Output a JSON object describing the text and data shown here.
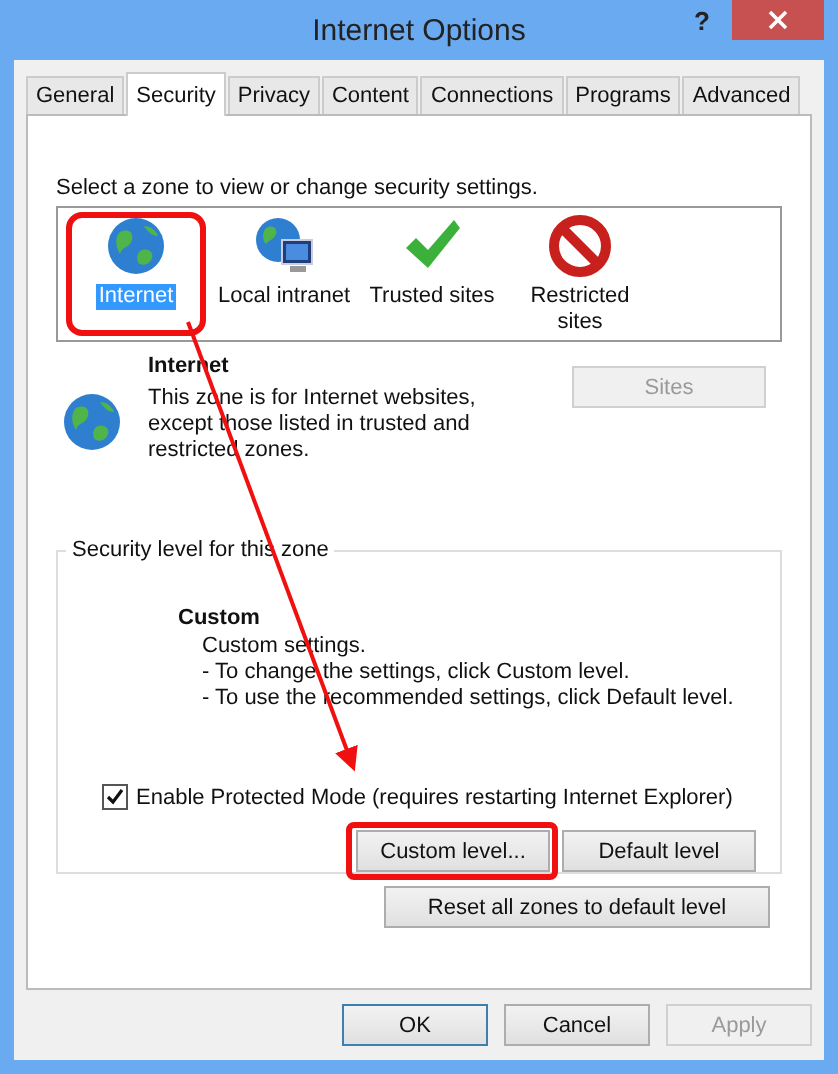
{
  "window": {
    "title": "Internet Options",
    "help": "?"
  },
  "tabs": [
    {
      "label": "General",
      "selected": false
    },
    {
      "label": "Security",
      "selected": true
    },
    {
      "label": "Privacy",
      "selected": false
    },
    {
      "label": "Content",
      "selected": false
    },
    {
      "label": "Connections",
      "selected": false
    },
    {
      "label": "Programs",
      "selected": false
    },
    {
      "label": "Advanced",
      "selected": false
    }
  ],
  "zone_prompt": "Select a zone to view or change security settings.",
  "zones": [
    {
      "kind": "globe",
      "label": "Internet",
      "selected": true
    },
    {
      "kind": "intranet",
      "label": "Local intranet",
      "selected": false
    },
    {
      "kind": "trusted",
      "label": "Trusted sites",
      "selected": false
    },
    {
      "kind": "restricted",
      "label": "Restricted sites",
      "selected": false
    }
  ],
  "zone_info": {
    "title": "Internet",
    "description": "This zone is for Internet websites, except those listed in trusted and restricted zones."
  },
  "sites_button": {
    "label": "Sites",
    "disabled": true
  },
  "security_level": {
    "legend": "Security level for this zone",
    "level_name": "Custom",
    "lines": [
      "Custom settings.",
      "- To change the settings, click Custom level.",
      "- To use the recommended settings, click Default level."
    ],
    "protected_mode": {
      "label": "Enable Protected Mode (requires restarting Internet Explorer)",
      "checked": true
    },
    "buttons": [
      "Custom level...",
      "Default level"
    ]
  },
  "reset_button": "Reset all zones to default level",
  "dialog_buttons": [
    {
      "label": "OK",
      "default": true,
      "disabled": false
    },
    {
      "label": "Cancel",
      "default": false,
      "disabled": false
    },
    {
      "label": "Apply",
      "default": false,
      "disabled": true
    }
  ]
}
